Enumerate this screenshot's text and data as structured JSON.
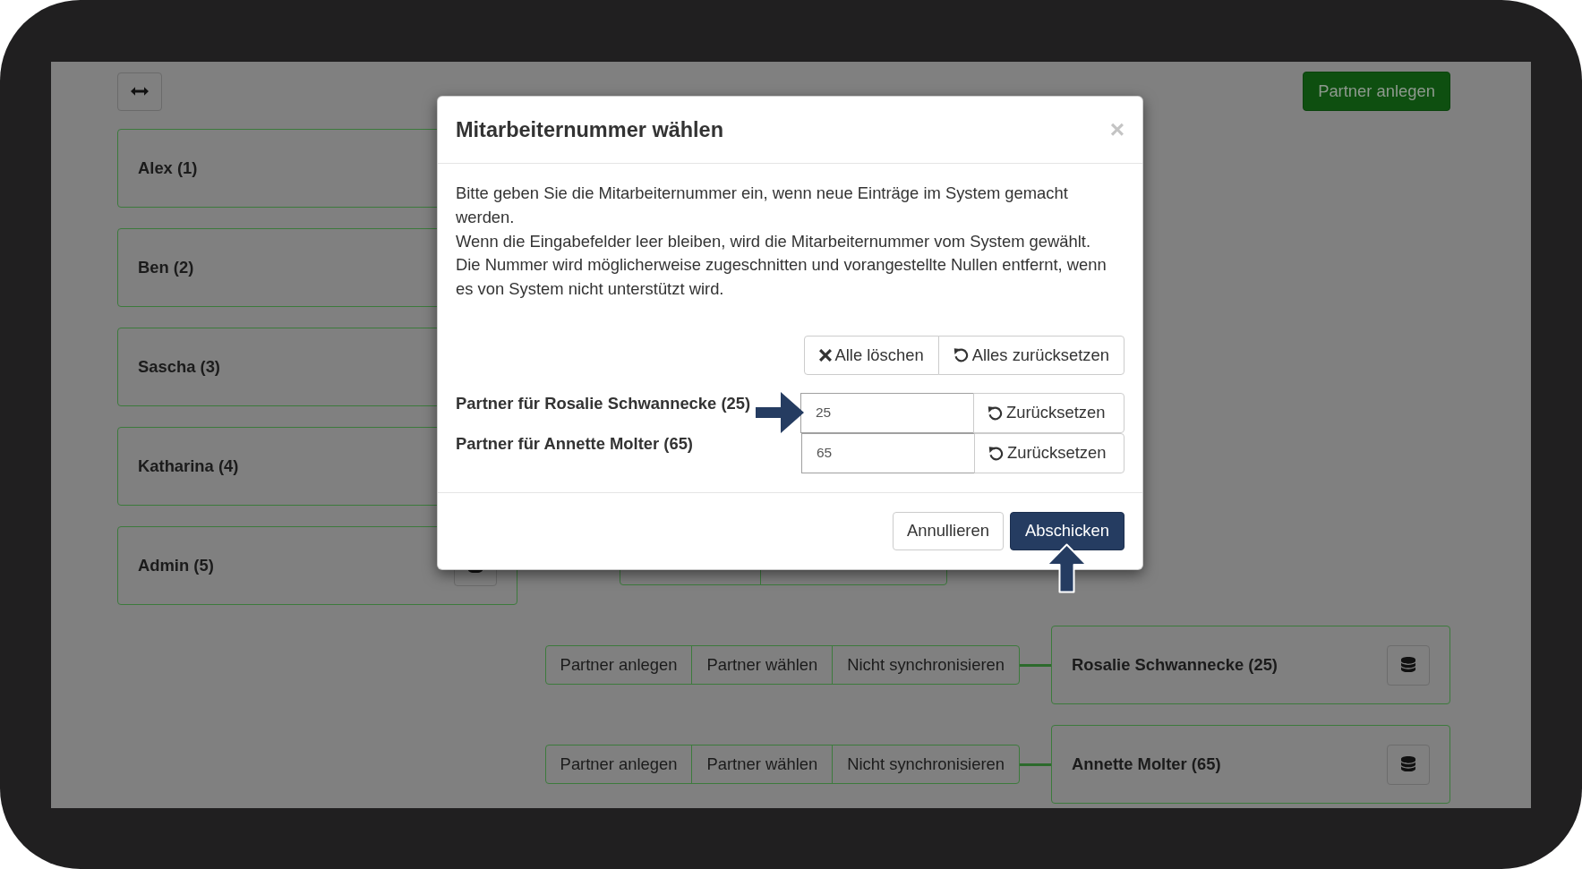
{
  "top_bar": {
    "create_partner_button": "Partner anlegen"
  },
  "users": [
    {
      "name": "Alex (1)"
    },
    {
      "name": "Ben (2)"
    },
    {
      "name": "Sascha (3)"
    },
    {
      "name": "Katharina (4)"
    },
    {
      "name": "Admin (5)",
      "database_button": true,
      "actions": [
        {
          "kind": "covered"
        },
        {
          "kind": "covered"
        }
      ]
    }
  ],
  "partner_rows": [
    {
      "actions": [
        {
          "kind": "labeled",
          "label": "Partner anlegen"
        },
        {
          "kind": "labeled",
          "label": "Partner wählen"
        },
        {
          "kind": "labeled",
          "label": "Nicht synchronisieren"
        }
      ],
      "name": "Rosalie Schwannecke (25)",
      "database_button": true
    },
    {
      "actions": [
        {
          "kind": "labeled",
          "label": "Partner anlegen"
        },
        {
          "kind": "labeled",
          "label": "Partner wählen"
        },
        {
          "kind": "labeled",
          "label": "Nicht synchronisieren"
        }
      ],
      "name": "Annette Molter (65)",
      "database_button": true
    }
  ],
  "dialog": {
    "title": "Mitarbeiternummer wählen",
    "close_button": "×",
    "text": [
      "Bitte geben Sie die Mitarbeiternummer ein, wenn neue Einträge im System gemacht werden.",
      "Wenn die Eingabefelder leer bleiben, wird die Mitarbeiternummer vom System gewählt.",
      "Die Nummer wird möglicherweise zugeschnitten und vorangestellte Nullen entfernt, wenn es von System nicht unterstützt wird."
    ],
    "bulk_actions": [
      {
        "kind": "clear",
        "label": "Alle löschen"
      },
      {
        "kind": "reset",
        "label": "Alles zurücksetzen"
      }
    ],
    "fields": [
      {
        "label": "Partner für Rosalie Schwannecke (25)",
        "value": "25",
        "reset_button": "Zurücksetzen",
        "marked": true
      },
      {
        "label": "Partner für Annette Molter (65)",
        "value": "65",
        "reset_button": "Zurücksetzen",
        "marked": false
      }
    ],
    "buttons": [
      {
        "kind": "default",
        "label": "Annullieren",
        "marked": false
      },
      {
        "kind": "primary",
        "label": "Abschicken",
        "marked": true
      }
    ]
  }
}
